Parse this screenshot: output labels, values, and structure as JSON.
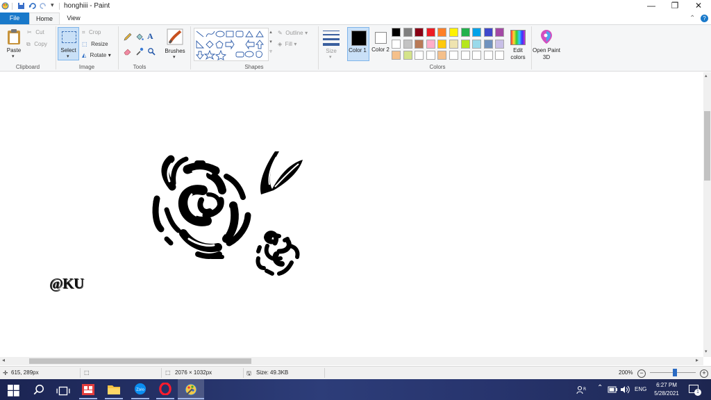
{
  "window": {
    "title": "honghiii - Paint",
    "tabs": [
      "File",
      "Home",
      "View"
    ]
  },
  "ribbon": {
    "clipboard": {
      "paste": "Paste",
      "cut": "Cut",
      "copy": "Copy",
      "label": "Clipboard"
    },
    "image": {
      "select": "Select",
      "crop": "Crop",
      "resize": "Resize",
      "rotate": "Rotate",
      "label": "Image"
    },
    "tools": {
      "label": "Tools"
    },
    "brushes": "Brushes",
    "shapes": {
      "outline": "Outline",
      "fill": "Fill",
      "label": "Shapes"
    },
    "size": "Size",
    "color1": "Color 1",
    "color2": "Color 2",
    "colors_label": "Colors",
    "edit_colors": "Edit colors",
    "open_paint3d": "Open Paint 3D",
    "palette_row1": [
      "#000000",
      "#7f7f7f",
      "#880015",
      "#ed1c24",
      "#ff7f27",
      "#fff200",
      "#22b14c",
      "#00a2e8",
      "#3f48cc",
      "#a349a4"
    ],
    "palette_row2": [
      "#ffffff",
      "#c3c3c3",
      "#b97a57",
      "#ffaec9",
      "#ffc90e",
      "#efe4b0",
      "#b5e61d",
      "#99d9ea",
      "#7092be",
      "#c8bfe7"
    ],
    "palette_row3": [
      "#f5c08a",
      "#d4e38a",
      "#ffffff",
      "#ffffff",
      "#f5c08a",
      "#ffffff",
      "#ffffff",
      "#ffffff",
      "#ffffff",
      "#ffffff"
    ],
    "color1_value": "#000000",
    "color2_value": "#ffffff"
  },
  "canvas": {
    "signature": "@KU"
  },
  "statusbar": {
    "cursor_pos": "615, 289px",
    "dimensions": "2076 × 1032px",
    "size": "Size: 49.3KB",
    "zoom": "200%",
    "zoom_fraction": 0.55
  },
  "taskbar": {
    "language": "ENG",
    "time": "6:27 PM",
    "date": "5/28/2021",
    "notification_count": "1"
  }
}
